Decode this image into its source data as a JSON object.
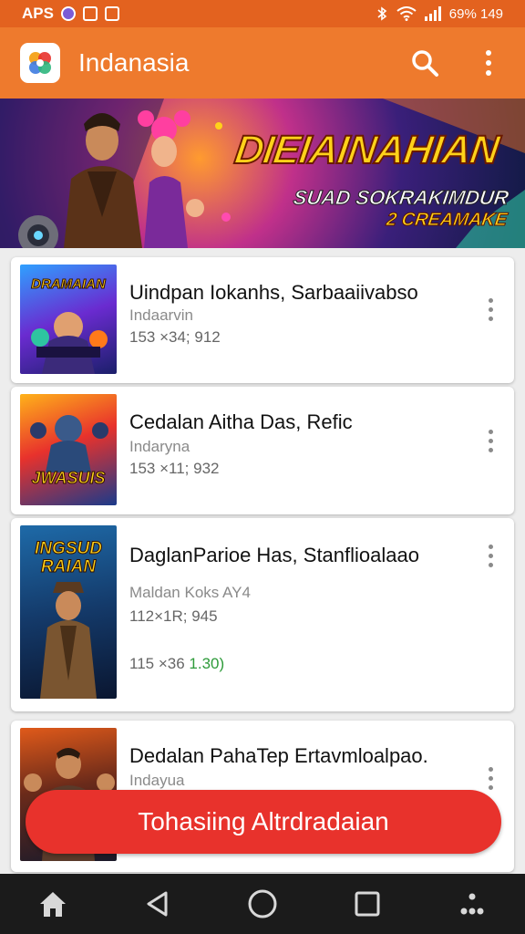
{
  "status_bar": {
    "left_text": "APS",
    "right_text": "69% 149"
  },
  "app_bar": {
    "title": "Indanasia",
    "icons": [
      "app-logo",
      "search-icon",
      "more-vert-icon"
    ]
  },
  "banner": {
    "headline": "DIEIAINAHIAN",
    "subline1": "SUAD SOKRAKIMDUR",
    "subline2": "2 CREAMAKE"
  },
  "cards": [
    {
      "thumb_caption": "DRAMAIAN",
      "title": "Uindpan Iokanhs, Sarbaaiivabso",
      "subtitle": "Indaarvin",
      "meta": "153 ×34; 912"
    },
    {
      "thumb_caption": "JWASUIS",
      "title": "Cedalan Aitha Das, Refic",
      "subtitle": "Indaryna",
      "meta": "153 ×11; 932"
    },
    {
      "thumb_caption": "INGSUD RAIAN",
      "title": "DaglanParioe Has, Stanflioalaao",
      "subtitle": "Maldan Koks AY4",
      "meta": "112×1R; 945",
      "extra": "115 ×36",
      "extra_highlight": "1.30)"
    },
    {
      "thumb_caption": "",
      "title": "Dedalan PahaTep Ertavmloalpao.",
      "subtitle": "Indayua"
    }
  ],
  "cta": {
    "label": "Tohasiing Altrdradaian"
  },
  "nav": [
    "home-icon",
    "back-icon",
    "circle-home-icon",
    "recents-icon",
    "apps-icon"
  ],
  "colors": {
    "status_bar": "#e3621f",
    "app_bar": "#ee7a2d",
    "cta": "#e8322c",
    "nav_bar": "#1b1b1b"
  }
}
